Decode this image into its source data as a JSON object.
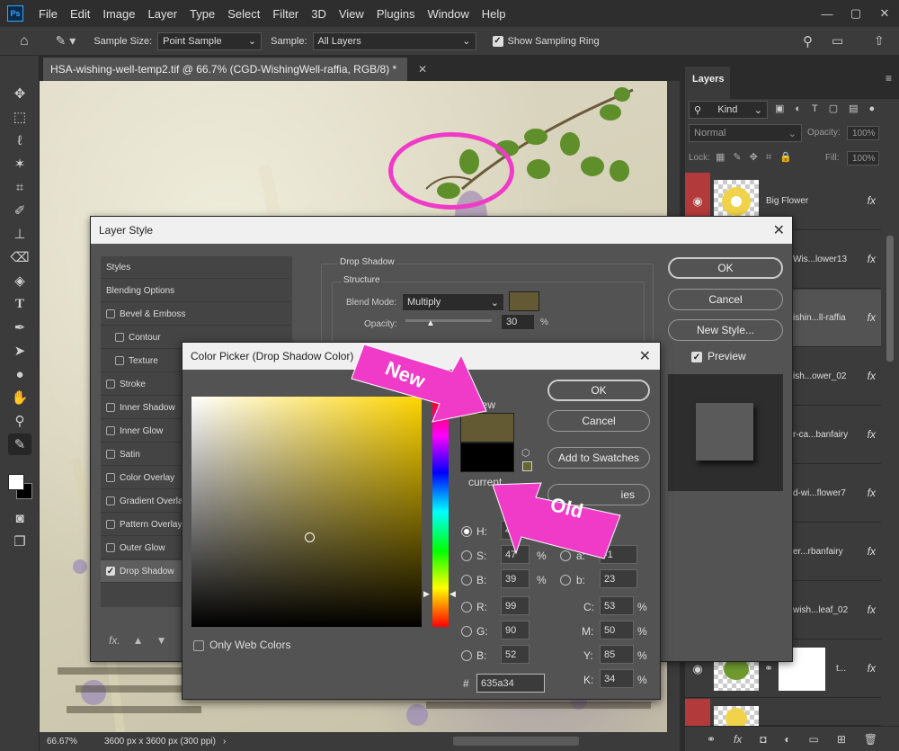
{
  "app": {
    "logo": "Ps",
    "window_buttons": [
      "—",
      "▢",
      "✕"
    ]
  },
  "menu": [
    "File",
    "Edit",
    "Image",
    "Layer",
    "Type",
    "Select",
    "Filter",
    "3D",
    "View",
    "Plugins",
    "Window",
    "Help"
  ],
  "options": {
    "sample_size_label": "Sample Size:",
    "sample_size_value": "Point Sample",
    "sample_label": "Sample:",
    "sample_value": "All Layers",
    "show_ring_label": "Show Sampling Ring"
  },
  "document": {
    "tab_title": "HSA-wishing-well-temp2.tif @ 66.7% (CGD-WishingWell-raffia, RGB/8) *",
    "zoom": "66.67%",
    "size_info": "3600 px x 3600 px (300 ppi)"
  },
  "layers_panel": {
    "tab": "Layers",
    "filter_placeholder": "Kind",
    "blend_mode": "Normal",
    "opacity_label": "Opacity:",
    "opacity_value": "100%",
    "lock_label": "Lock:",
    "fill_label": "Fill:",
    "fill_value": "100%",
    "fx": "fx",
    "layers": [
      {
        "name": "Big Flower"
      },
      {
        "name": "Wis...lower13"
      },
      {
        "name": "ishin...ll-raffia"
      },
      {
        "name": "ish...ower_02"
      },
      {
        "name": "r-ca...banfairy"
      },
      {
        "name": "d-wi...flower7"
      },
      {
        "name": "er...rbanfairy"
      },
      {
        "name": "wish...leaf_02"
      },
      {
        "name": "t..."
      }
    ]
  },
  "layer_style": {
    "title": "Layer Style",
    "styles_header": "Styles",
    "items": [
      "Blending Options",
      "Bevel & Emboss",
      "Contour",
      "Texture",
      "Stroke",
      "Inner Shadow",
      "Inner Glow",
      "Satin",
      "Color Overlay",
      "Gradient Overla",
      "Pattern Overlay",
      "Outer Glow",
      "Drop Shadow"
    ],
    "section": "Drop Shadow",
    "structure": "Structure",
    "blend_mode_label": "Blend Mode:",
    "blend_mode_value": "Multiply",
    "opacity_label": "Opacity:",
    "opacity_value": "30",
    "percent": "%",
    "ok": "OK",
    "cancel": "Cancel",
    "new_style": "New Style...",
    "preview": "Preview",
    "fx_label": "fx."
  },
  "color_picker": {
    "title": "Color Picker (Drop Shadow Color)",
    "new_label": "new",
    "current_label": "current",
    "ok": "OK",
    "cancel": "Cancel",
    "add_swatches": "Add to Swatches",
    "libraries": "ies",
    "only_web": "Only Web Colors",
    "H": "49",
    "S": "47",
    "B": "39",
    "R": "99",
    "G": "90",
    "B2": "52",
    "a": "-1",
    "b": "23",
    "C": "53",
    "M": "50",
    "Y": "85",
    "K": "34",
    "hex": "635a34",
    "deg": "°",
    "pct": "%",
    "hash": "#",
    "labels": {
      "H": "H:",
      "S": "S:",
      "B": "B:",
      "R": "R:",
      "G": "G:",
      "B2": "B:",
      "a": "a:",
      "b": "b:",
      "C": "C:",
      "M": "M:",
      "Y": "Y:",
      "K": "K:"
    },
    "new_color": "#635a34",
    "current_color": "#000000"
  },
  "annotations": {
    "new": "New",
    "old": "Old",
    "accent": "#f03ac8"
  }
}
